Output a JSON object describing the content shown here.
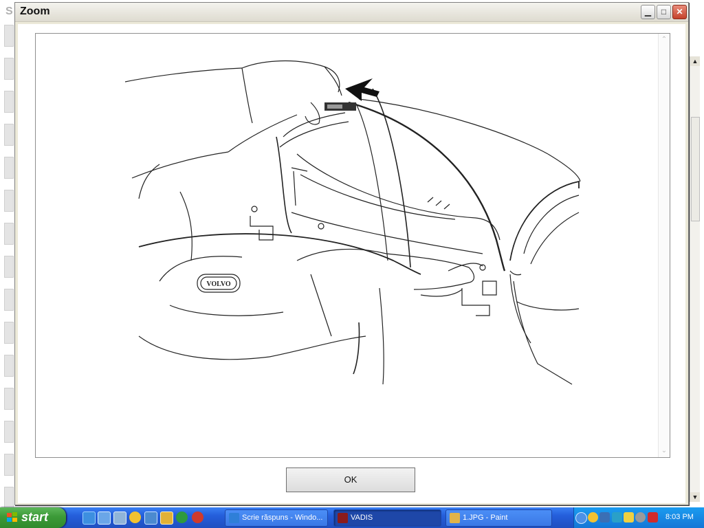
{
  "background_app": {
    "title_fragment": "S"
  },
  "dialog": {
    "title": "Zoom",
    "ok_label": "OK",
    "image_badge_text": "VOLVO"
  },
  "taskbar": {
    "start_label": "start",
    "tasks": [
      {
        "label": "Scrie răspuns - Windo...",
        "icon": "ie-icon"
      },
      {
        "label": "VADIS",
        "icon": "vadis-icon",
        "active": true
      },
      {
        "label": "1.JPG - Paint",
        "icon": "paint-icon"
      }
    ],
    "clock": "8:03 PM"
  },
  "colors": {
    "taskbar_blue": "#245edb",
    "start_green": "#3c9a38",
    "tray_blue": "#1476d6",
    "close_red": "#c4412a"
  }
}
